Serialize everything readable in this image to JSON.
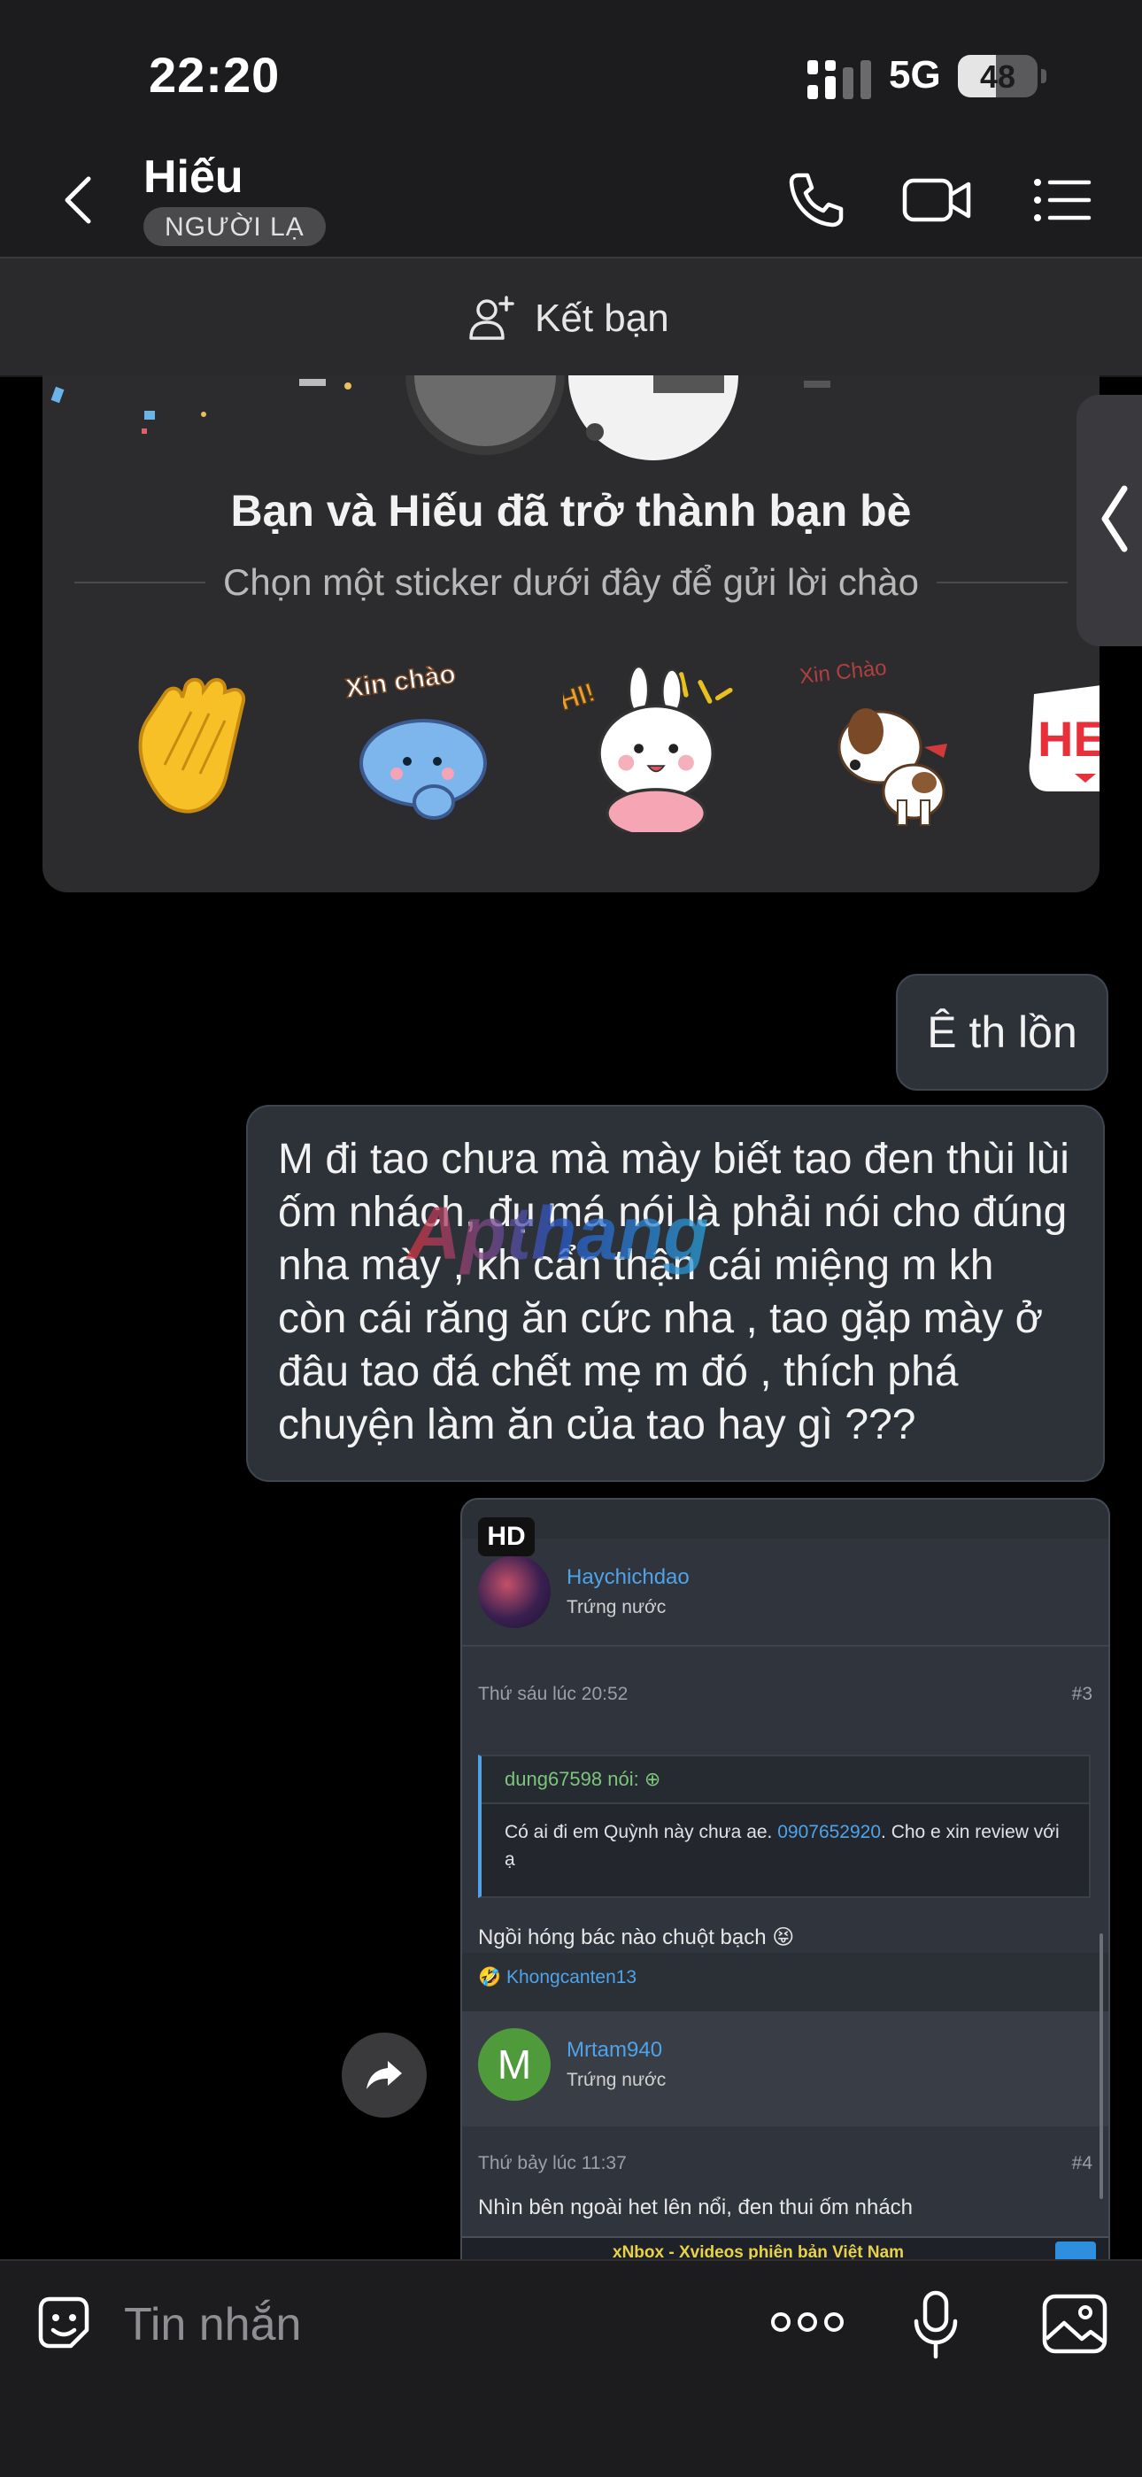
{
  "status_bar": {
    "time": "22:20",
    "network": "5G",
    "battery": "48",
    "battery_level_percent": 48
  },
  "header": {
    "contact_name": "Hiếu",
    "badge": "NGƯỜI LẠ"
  },
  "friend_bar": {
    "label": "Kết bạn"
  },
  "sticker_card": {
    "title": "Bạn và Hiếu đã trở thành bạn bè",
    "subtitle": "Chọn một sticker dưới đây để gửi lời chào",
    "stickers": [
      "waving-hand-sticker",
      "xin-chao-blue-sticker",
      "hi-bunny-sticker",
      "xin-chao-puppy-sticker",
      "hello-heart-sticker"
    ],
    "sticker_text": {
      "xin_chao": "Xin chào",
      "hi": "HI!",
      "xin_chao_puppy": "Xin Chào",
      "hello_partial": "HE"
    }
  },
  "messages": [
    {
      "text": "Ê th lồn"
    },
    {
      "text": "M đi tao chưa mà mày biết tao đen thùi lùi ốm nhách, đụ má nói là phải nói cho đúng nha mày , kh cẩn thận cái miệng m kh còn cái răng ăn cức nha , tao gặp mày ở đâu tao đá chết mẹ m đó , thích phá chuyện làm ăn của tao hay gì ???"
    }
  ],
  "watermark": "Apthang",
  "shared_image": {
    "badge": "HD",
    "post1": {
      "username": "Haychichdao",
      "rank": "Trứng nước",
      "timestamp": "Thứ sáu lúc 20:52",
      "number": "#3",
      "quote_author": "dung67598 nói: ⊕",
      "quote_text_before": "Có ai đi em Quỳnh này chưa ae. ",
      "quote_phone": "0907652920",
      "quote_text_after": ". Cho e xin review với ạ",
      "body": "Ngồi hóng bác nào chuột bạch 😝",
      "reaction": "🤣 Khongcanten13"
    },
    "post2": {
      "avatar_letter": "M",
      "username": "Mrtam940",
      "rank": "Trứng nước",
      "timestamp": "Thứ bảy lúc 11:37",
      "number": "#4",
      "body": "Nhìn bên ngoài het lên nổi, đen thui ốm nhách"
    },
    "next_bar": "xNbox - Xvideos phiên bản Việt Nam"
  },
  "input_bar": {
    "placeholder": "Tin nhắn",
    "more_label": "ooo"
  },
  "colors": {
    "background": "#000000",
    "bar": "#1c1c1e",
    "bubble": "#2c3238",
    "link": "#4fa3e8",
    "green_avatar": "#4f9a3a"
  }
}
